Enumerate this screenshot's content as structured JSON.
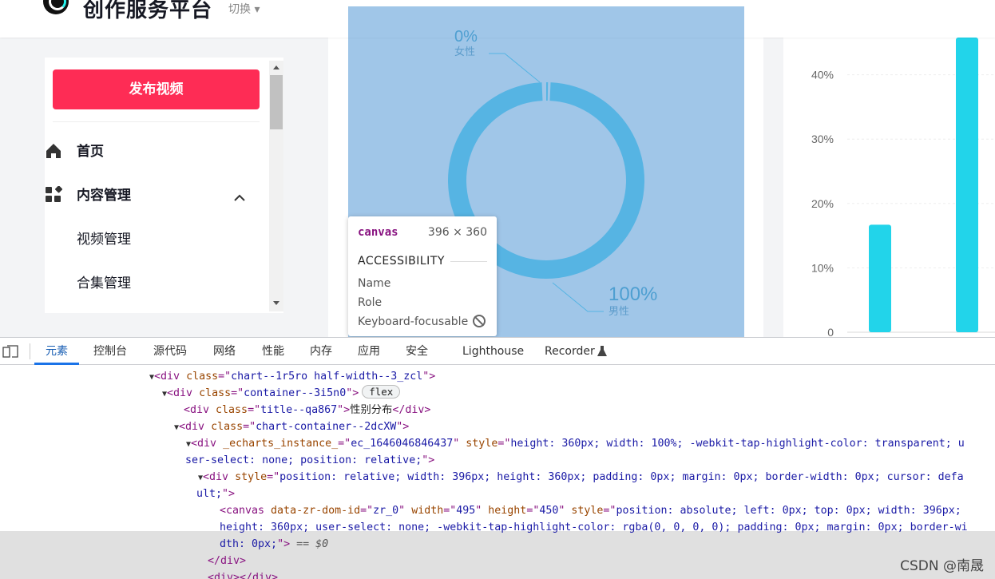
{
  "topbar": {
    "brand": "创作服务平台",
    "switch_label": "切换 ▾"
  },
  "sidebar": {
    "publish_label": "发布视频",
    "nav": [
      {
        "label": "首页",
        "icon": "home-icon"
      },
      {
        "label": "内容管理",
        "icon": "apps-icon",
        "expanded": true
      },
      {
        "label": "视频管理"
      },
      {
        "label": "合集管理"
      }
    ]
  },
  "gender_chart": {
    "chart_data": {
      "type": "pie",
      "series": [
        {
          "name": "男性",
          "value": 100,
          "label": "100%"
        },
        {
          "name": "女性",
          "value": 0,
          "label": "0%"
        }
      ],
      "colors": [
        "#56b4e3",
        "#56b4e3"
      ]
    }
  },
  "age_chart": {
    "chart_data": {
      "type": "bar",
      "y_ticks": [
        "0",
        "10%",
        "20%",
        "30%",
        "40%"
      ],
      "ylim": [
        0,
        0.47
      ],
      "values": [
        0.167,
        1.0
      ],
      "color": "#22d4ea"
    }
  },
  "tooltip": {
    "tag": "canvas",
    "size": "396 × 360",
    "heading": "ACCESSIBILITY",
    "rows": [
      "Name",
      "Role",
      "Keyboard-focusable"
    ]
  },
  "devtools": {
    "tabs": [
      "元素",
      "控制台",
      "源代码",
      "网络",
      "性能",
      "内存",
      "应用",
      "安全",
      "Lighthouse",
      "Recorder"
    ],
    "active_tab": "元素",
    "lines": [
      {
        "indent": 187,
        "tri": "▼",
        "parts": [
          [
            "tg",
            "<div "
          ],
          [
            "an",
            "class"
          ],
          [
            "tg",
            "=\""
          ],
          [
            "av",
            "chart--1r5ro half-width--3_zcl"
          ],
          [
            "tg",
            "\">"
          ]
        ]
      },
      {
        "indent": 203,
        "tri": "▼",
        "parts": [
          [
            "tg",
            "<div "
          ],
          [
            "an",
            "class"
          ],
          [
            "tg",
            "=\""
          ],
          [
            "av",
            "container--3i5n0"
          ],
          [
            "tg",
            "\">"
          ]
        ],
        "badge": "flex"
      },
      {
        "indent": 230,
        "tri": "",
        "parts": [
          [
            "tg",
            "<div "
          ],
          [
            "an",
            "class"
          ],
          [
            "tg",
            "=\""
          ],
          [
            "av",
            "title--qa867"
          ],
          [
            "tg",
            "\">"
          ],
          [
            "tx",
            "性别分布"
          ],
          [
            "tg",
            "</div>"
          ]
        ]
      },
      {
        "indent": 218,
        "tri": "▼",
        "parts": [
          [
            "tg",
            "<div "
          ],
          [
            "an",
            "class"
          ],
          [
            "tg",
            "=\""
          ],
          [
            "av",
            "chart-container--2dcXW"
          ],
          [
            "tg",
            "\">"
          ]
        ]
      },
      {
        "indent": 233,
        "tri": "▼",
        "parts": [
          [
            "tg",
            "<div "
          ],
          [
            "an",
            "_echarts_instance_"
          ],
          [
            "tg",
            "=\""
          ],
          [
            "av",
            "ec_1646046846437"
          ],
          [
            "tg",
            "\" "
          ],
          [
            "an",
            "style"
          ],
          [
            "tg",
            "=\""
          ],
          [
            "av",
            "height: 360px; width: 100%; -webkit-tap-highlight-color: transparent; u"
          ]
        ]
      },
      {
        "indent": 232,
        "tri": "",
        "parts": [
          [
            "av",
            "ser-select: none; position: relative;"
          ],
          [
            "tg",
            "\">"
          ]
        ]
      },
      {
        "indent": 248,
        "tri": "▼",
        "parts": [
          [
            "tg",
            "<div "
          ],
          [
            "an",
            "style"
          ],
          [
            "tg",
            "=\""
          ],
          [
            "av",
            "position: relative; width: 396px; height: 360px; padding: 0px; margin: 0px; border-width: 0px; cursor: defa"
          ]
        ]
      },
      {
        "indent": 246,
        "tri": "",
        "parts": [
          [
            "av",
            "ult;"
          ],
          [
            "tg",
            "\">"
          ]
        ]
      },
      {
        "indent": 275,
        "tri": "",
        "parts": [
          [
            "tg",
            "<canvas "
          ],
          [
            "an",
            "data-zr-dom-id"
          ],
          [
            "tg",
            "=\""
          ],
          [
            "av",
            "zr_0"
          ],
          [
            "tg",
            "\" "
          ],
          [
            "an",
            "width"
          ],
          [
            "tg",
            "=\""
          ],
          [
            "av",
            "495"
          ],
          [
            "tg",
            "\" "
          ],
          [
            "an",
            "height"
          ],
          [
            "tg",
            "=\""
          ],
          [
            "av",
            "450"
          ],
          [
            "tg",
            "\" "
          ],
          [
            "an",
            "style"
          ],
          [
            "tg",
            "=\""
          ],
          [
            "av",
            "position: absolute; left: 0px; top: 0px; width: 396px;"
          ]
        ]
      },
      {
        "indent": 275,
        "tri": "",
        "parts": [
          [
            "av",
            "height: 360px; user-select: none; -webkit-tap-highlight-color: rgba(0, 0, 0, 0); padding: 0px; margin: 0px; border-wi"
          ]
        ]
      },
      {
        "indent": 275,
        "tri": "",
        "parts": [
          [
            "av",
            "dth: 0px;"
          ],
          [
            "tg",
            "\">"
          ],
          [
            "eq",
            " == $0"
          ]
        ]
      },
      {
        "indent": 260,
        "tri": "",
        "parts": [
          [
            "tg",
            "</div>"
          ]
        ]
      },
      {
        "indent": 260,
        "tri": "",
        "parts": [
          [
            "tg",
            "<div></div>"
          ]
        ]
      }
    ]
  },
  "watermark": "CSDN @南晟"
}
